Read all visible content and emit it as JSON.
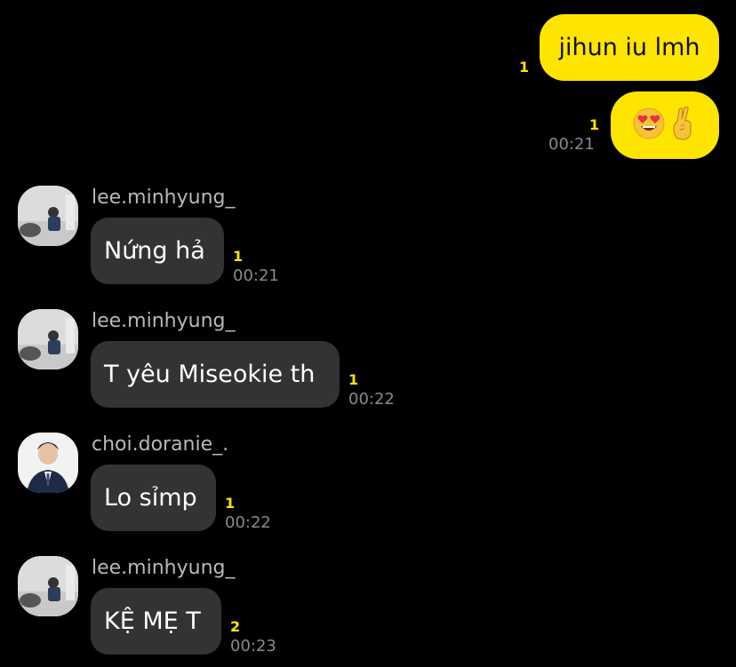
{
  "messages": [
    {
      "type": "outgoing",
      "text": "jihun iu lmh",
      "unread": "1",
      "time": ""
    },
    {
      "type": "outgoing-emoji",
      "unread": "1",
      "time": "00:21",
      "emoji": [
        "heart-eyes",
        "crossed-fingers"
      ]
    },
    {
      "type": "incoming",
      "sender": "lee.minhyung_",
      "text": "Nứng hả",
      "unread": "1",
      "time": "00:21"
    },
    {
      "type": "incoming",
      "sender": "lee.minhyung_",
      "text": "T yêu Miseokie th",
      "unread": "1",
      "time": "00:22"
    },
    {
      "type": "incoming",
      "sender": "choi.doranie_.",
      "text": "Lo sỉmp",
      "unread": "1",
      "time": "00:22"
    },
    {
      "type": "incoming",
      "sender": "lee.minhyung_",
      "text": "KỆ MẸ T",
      "unread": "2",
      "time": "00:23"
    }
  ],
  "colors": {
    "background": "#000000",
    "outgoing_bubble": "#FEE500",
    "incoming_bubble": "#333333",
    "unread": "#FEE500",
    "time": "#8a8a8a",
    "sender": "#b8b8b8"
  }
}
